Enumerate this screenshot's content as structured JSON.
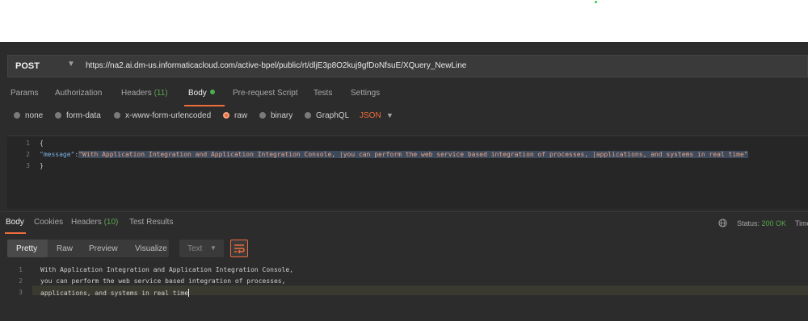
{
  "request": {
    "method": "POST",
    "url": "https://na2.ai.dm-us.informaticacloud.com/active-bpel/public/rt/dljE3p8O2kuj9gfDoNfsuE/XQuery_NewLine"
  },
  "request_tabs": [
    {
      "label": "Params"
    },
    {
      "label": "Authorization"
    },
    {
      "label": "Headers",
      "count": "(11)"
    },
    {
      "label": "Body",
      "active": true
    },
    {
      "label": "Pre-request Script"
    },
    {
      "label": "Tests"
    },
    {
      "label": "Settings"
    }
  ],
  "body_types": {
    "none": "none",
    "form_data": "form-data",
    "urlencoded": "x-www-form-urlencoded",
    "raw": "raw",
    "binary": "binary",
    "graphql": "GraphQL",
    "format": "JSON",
    "selected": "raw"
  },
  "request_editor": {
    "line_numbers": [
      "1",
      "2",
      "3"
    ],
    "open_brace": "{",
    "key": "\"message\"",
    "colon": ":",
    "value": "\"With Application Integration and Application Integration Console, |you can perform the web service based integration of processes, |applications, and systems in real time\"",
    "close_brace": "}"
  },
  "response_tabs": {
    "body": "Body",
    "cookies": "Cookies",
    "headers": "Headers",
    "headers_count": "(10)",
    "test_results": "Test Results",
    "status_label": "Status:",
    "status_value": "200 OK",
    "time_label": "Time"
  },
  "response_toolbar": {
    "pretty": "Pretty",
    "raw": "Raw",
    "preview": "Preview",
    "visualize": "Visualize",
    "format": "Text"
  },
  "response_editor": {
    "line_numbers": [
      "1",
      "2",
      "3"
    ],
    "line1": "With Application Integration and Application Integration Console,",
    "line2": "you can perform the web service based integration of processes,",
    "line3": "applications, and systems in real time"
  },
  "colors": {
    "accent": "#ef6c3b",
    "success": "#5aa64f",
    "background": "#2c2c2c"
  },
  "icons": [
    "chevron-down-icon",
    "globe-icon",
    "wrap-lines-icon"
  ]
}
